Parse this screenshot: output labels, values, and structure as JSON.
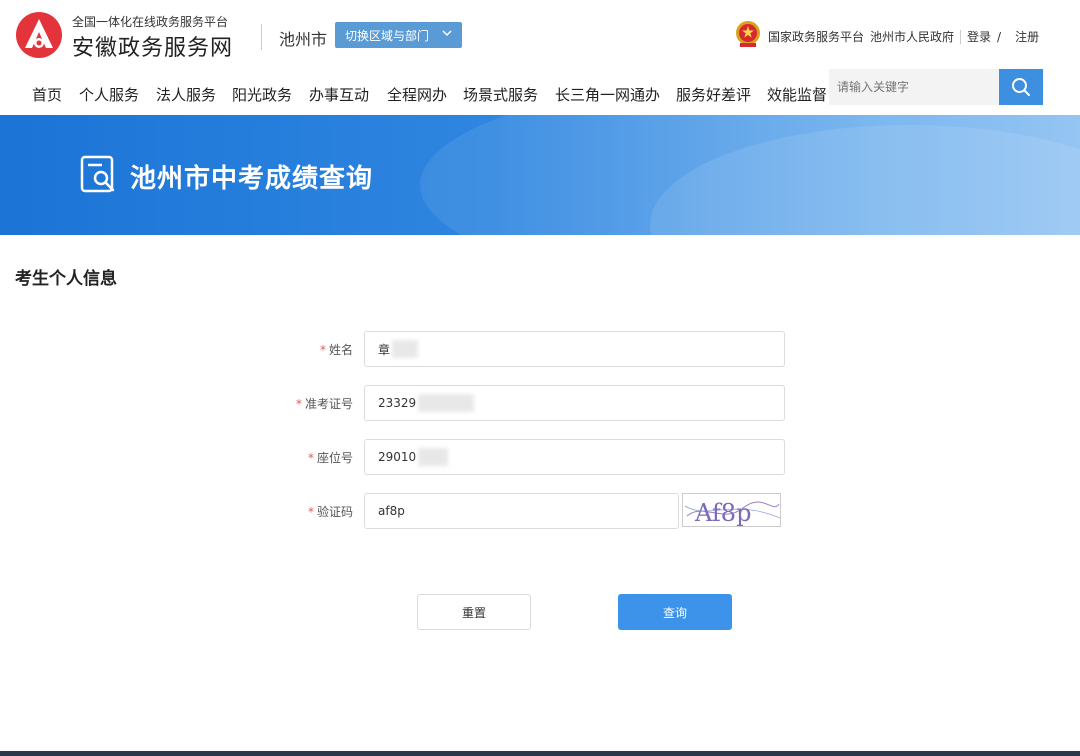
{
  "header": {
    "logo_subtitle": "全国一体化在线政务服务平台",
    "logo_title": "安徽政务服务网",
    "city": "池州市",
    "switch_label": "切换区域与部门",
    "national_platform": "国家政务服务平台",
    "city_gov": "池州市人民政府",
    "login": "登录",
    "slash": "/",
    "register": "注册"
  },
  "nav": {
    "items": [
      "首页",
      "个人服务",
      "法人服务",
      "阳光政务",
      "办事互动",
      "全程网办",
      "场景式服务",
      "长三角一网通办",
      "服务好差评",
      "效能监督"
    ],
    "search_placeholder": "请输入关键字"
  },
  "banner": {
    "title": "池州市中考成绩查询"
  },
  "form": {
    "section_title": "考生个人信息",
    "required_mark": "*",
    "fields": [
      {
        "label": "姓名",
        "value": "章"
      },
      {
        "label": "准考证号",
        "value": "23329"
      },
      {
        "label": "座位号",
        "value": "29010"
      },
      {
        "label": "验证码",
        "value": "af8p"
      }
    ],
    "captcha_text": "Af8p",
    "reset_label": "重置",
    "query_label": "查询"
  },
  "colors": {
    "accent": "#3d93ea",
    "required": "#e05a5a",
    "switch_bg": "#5b9bd5",
    "banner": "#1b74d6"
  }
}
